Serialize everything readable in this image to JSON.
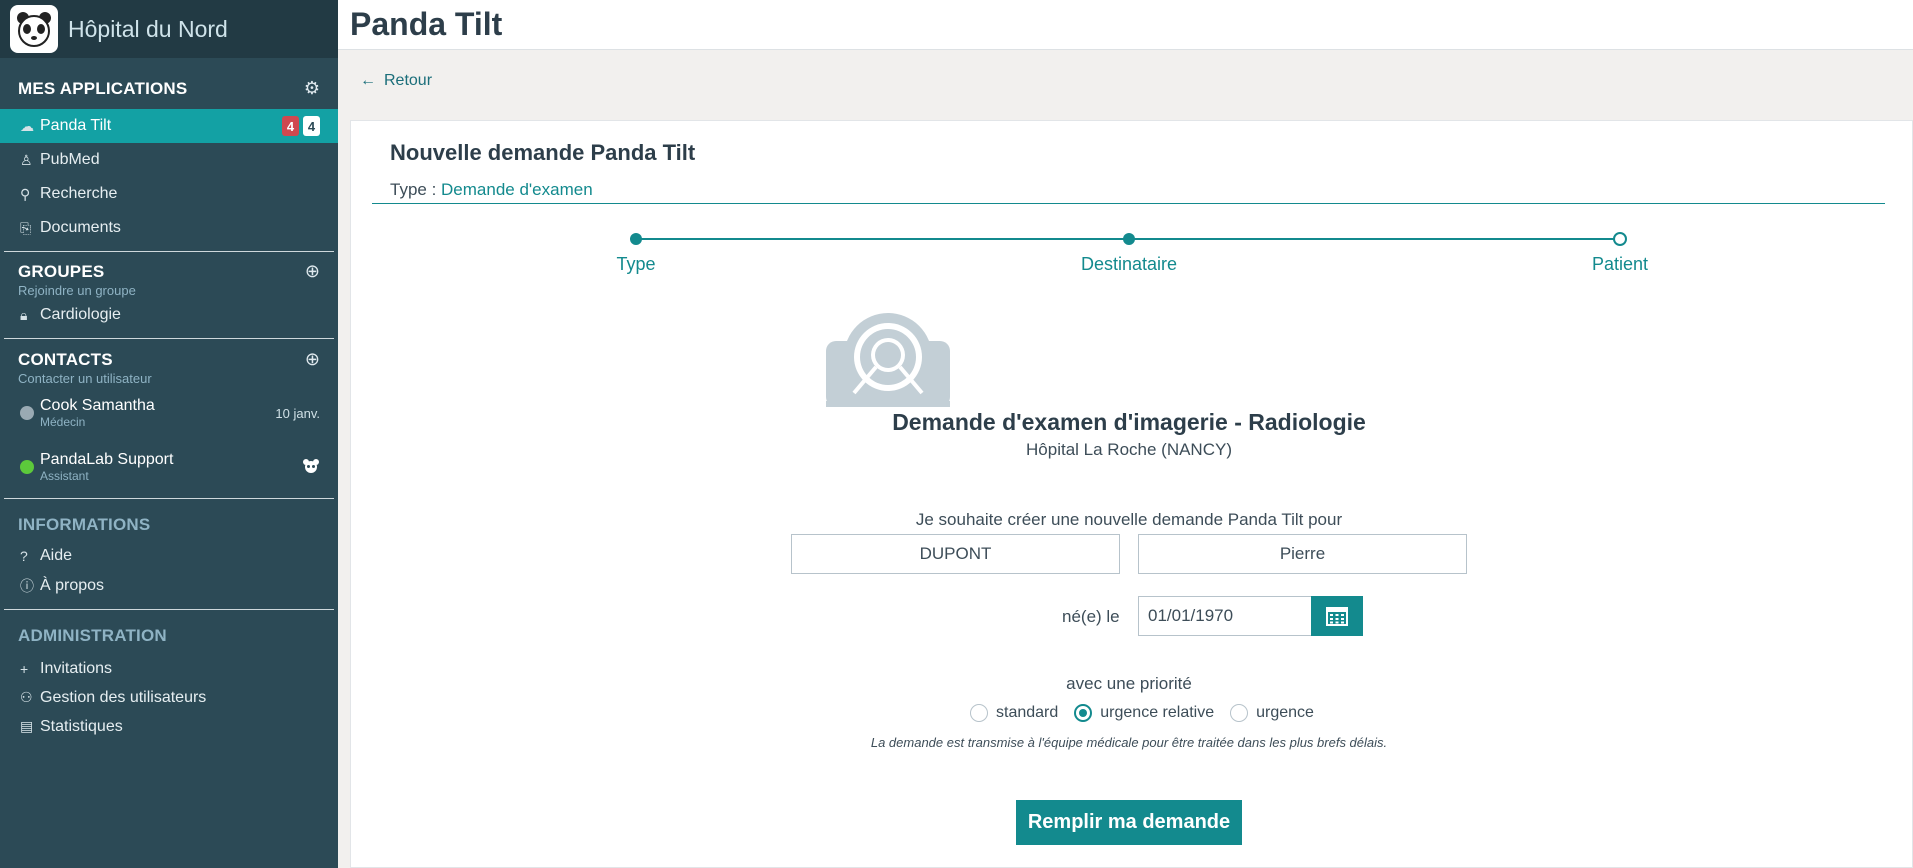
{
  "hospital": "Hôpital du Nord",
  "app_title": "Panda Tilt",
  "sidebar": {
    "apps_title": "MES APPLICATIONS",
    "apps": [
      {
        "label": "Panda Tilt",
        "icon": "cloud-icon",
        "badge_red": "4",
        "badge_white": "4"
      },
      {
        "label": "PubMed",
        "icon": "microscope-icon"
      },
      {
        "label": "Recherche",
        "icon": "search-icon"
      },
      {
        "label": "Documents",
        "icon": "paperclip-icon"
      }
    ],
    "groups_title": "GROUPES",
    "groups_sub": "Rejoindre un groupe",
    "groups": [
      {
        "label": "Cardiologie",
        "icon": "lock-icon"
      }
    ],
    "contacts_title": "CONTACTS",
    "contacts_sub": "Contacter un utilisateur",
    "contacts": [
      {
        "name": "Cook Samantha",
        "role": "Médecin",
        "right": "10 janv.",
        "status_color": "#9aaab3"
      },
      {
        "name": "PandaLab Support",
        "role": "Assistant",
        "right": "",
        "status_color": "#5cc93b"
      }
    ],
    "info_title": "INFORMATIONS",
    "info": [
      {
        "label": "Aide",
        "icon": "?"
      },
      {
        "label": "À propos",
        "icon": "ⓘ"
      }
    ],
    "admin_title": "ADMINISTRATION",
    "admin": [
      {
        "label": "Invitations",
        "icon": "+"
      },
      {
        "label": "Gestion des utilisateurs",
        "icon": "users-icon"
      },
      {
        "label": "Statistiques",
        "icon": "chart-icon"
      }
    ]
  },
  "back_label": "Retour",
  "form": {
    "title": "Nouvelle demande Panda Tilt",
    "type_label": "Type : ",
    "type_value": "Demande d'examen",
    "steps": [
      "Type",
      "Destinataire",
      "Patient"
    ],
    "request_title": "Demande d'examen d'imagerie - Radiologie",
    "request_sub": "Hôpital La Roche (NANCY)",
    "intro": "Je souhaite créer une nouvelle demande Panda Tilt pour",
    "last_name": "DUPONT",
    "first_name": "Pierre",
    "dob_label": "né(e) le",
    "dob": "01/01/1970",
    "priority_label": "avec une priorité",
    "priorities": [
      "standard",
      "urgence relative",
      "urgence"
    ],
    "selected_priority": "urgence relative",
    "note": "La demande est transmise à l'équipe médicale pour être traitée dans les plus brefs délais.",
    "submit": "Remplir ma demande"
  },
  "colors": {
    "accent": "#138a8e",
    "sidebar": "#2c4a56",
    "active": "#13a1a4"
  }
}
